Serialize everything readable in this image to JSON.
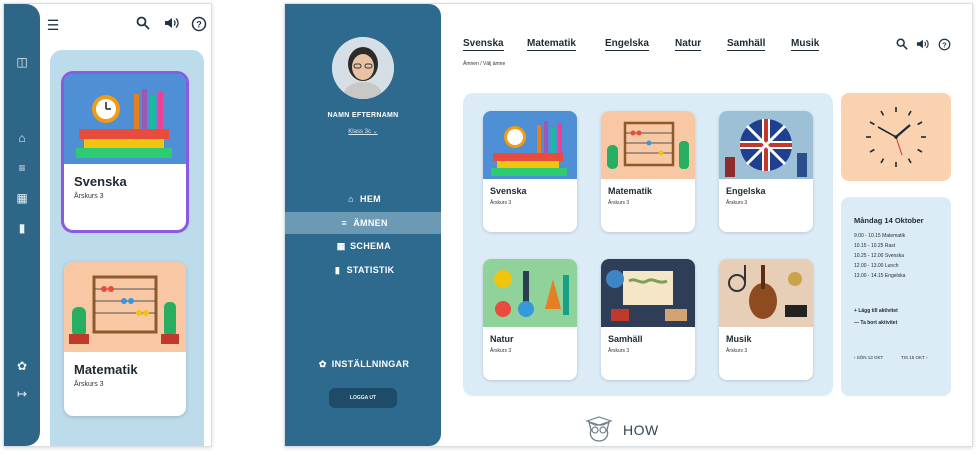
{
  "mobile": {
    "cards": [
      {
        "title": "Svenska",
        "grade": "Årskurs 3"
      },
      {
        "title": "Matematik",
        "grade": "Årskurs 3"
      }
    ]
  },
  "sidebar": {
    "user_name": "NAMN EFTERNAMN",
    "class_label": "Klass 3c",
    "nav": [
      {
        "label": "HEM",
        "icon": "home-icon"
      },
      {
        "label": "ÄMNEN",
        "icon": "list-icon"
      },
      {
        "label": "SCHEMA",
        "icon": "calendar-icon"
      },
      {
        "label": "STATISTIK",
        "icon": "bar-chart-icon"
      }
    ],
    "settings_label": "INSTÄLLNINGAR",
    "logout_label": "LOGGA UT"
  },
  "topnav": {
    "tabs": [
      "Svenska",
      "Matematik",
      "Engelska",
      "Natur",
      "Samhäll",
      "Musik"
    ],
    "breadcrumb": "Ämnen / Välj ämne"
  },
  "subjects": [
    {
      "title": "Svenska",
      "grade": "Årskurs 3"
    },
    {
      "title": "Matematik",
      "grade": "Årskurs 3"
    },
    {
      "title": "Engelska",
      "grade": "Årskurs 3"
    },
    {
      "title": "Natur",
      "grade": "Årskurs 3"
    },
    {
      "title": "Samhäll",
      "grade": "Årskurs 3"
    },
    {
      "title": "Musik",
      "grade": "Årskurs 3"
    }
  ],
  "schedule": {
    "date": "Måndag 14 Oktober",
    "rows": [
      "9.00 - 10.15 Matematik",
      "10.15 - 10.25 Rast",
      "10.25 - 12.00 Svenska",
      "12.00 - 13.00 Lunch",
      "13.00 - 14.15 Engelska"
    ],
    "add_label": "Lägg till aktivitet",
    "remove_label": "Ta bort aktivitet",
    "prev_label": "SÖN 13 OKT",
    "next_label": "TIS 15 OKT"
  },
  "brand": {
    "name": "HOW"
  },
  "colors": {
    "sidebar": "#2e6a8e",
    "panel": "#dbecf7",
    "accent": "#8a5be0",
    "clock_bg": "#fbd2b0"
  }
}
